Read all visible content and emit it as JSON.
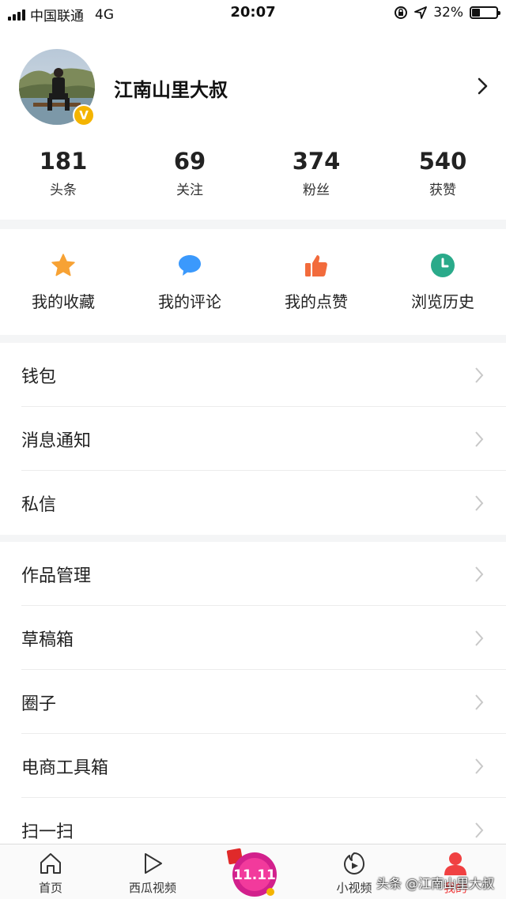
{
  "status_bar": {
    "carrier": "中国联通",
    "network": "4G",
    "time": "20:07",
    "battery": "32%",
    "battery_level": 0.32
  },
  "profile": {
    "username": "江南山里大叔",
    "badge": "V"
  },
  "stats": [
    {
      "value": "181",
      "label": "头条"
    },
    {
      "value": "69",
      "label": "关注"
    },
    {
      "value": "374",
      "label": "粉丝"
    },
    {
      "value": "540",
      "label": "获赞"
    }
  ],
  "quick_actions": [
    {
      "label": "我的收藏",
      "icon": "star-icon",
      "color": "#f7a234"
    },
    {
      "label": "我的评论",
      "icon": "comment-icon",
      "color": "#3b99fc"
    },
    {
      "label": "我的点赞",
      "icon": "thumbs-up-icon",
      "color": "#f26b3c"
    },
    {
      "label": "浏览历史",
      "icon": "clock-icon",
      "color": "#2aaa8a"
    }
  ],
  "menu_group_1": [
    "钱包",
    "消息通知",
    "私信"
  ],
  "menu_group_2": [
    "作品管理",
    "草稿箱",
    "圈子",
    "电商工具箱",
    "扫一扫"
  ],
  "tabbar": {
    "home": "首页",
    "xigua": "西瓜视频",
    "promo": "11.11",
    "short_video": "小视频",
    "mine": "我的"
  },
  "watermark": "头条 @江南山里大叔",
  "colors": {
    "accent_red": "#f04142",
    "badge_gold": "#f4b400"
  }
}
